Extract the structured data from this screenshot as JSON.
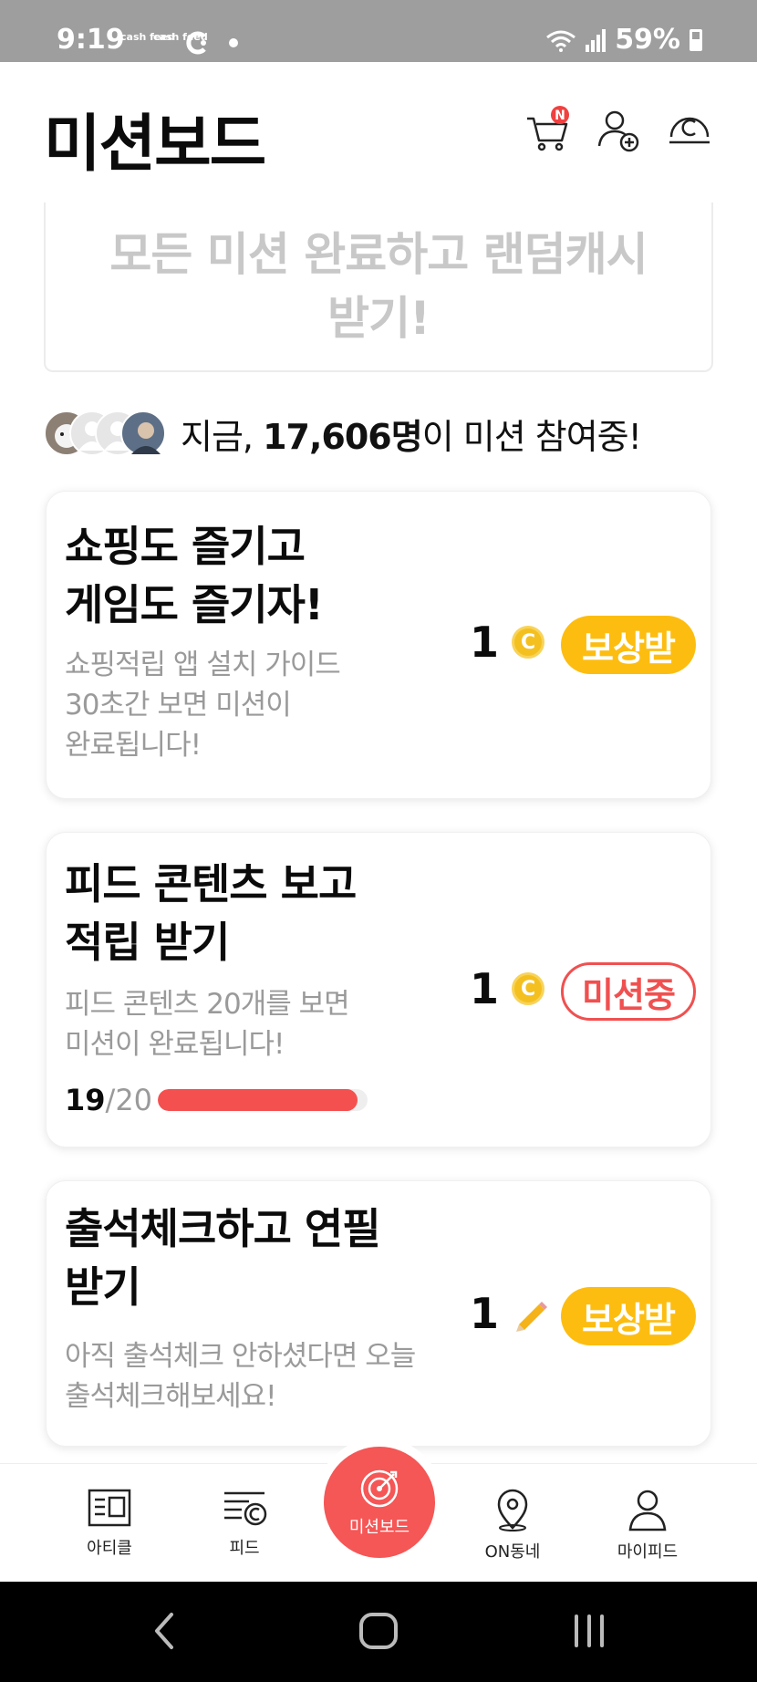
{
  "status_bar": {
    "time": "9:19",
    "app_icons": [
      "cash feed",
      "cash feed"
    ],
    "battery": "59%"
  },
  "header": {
    "title": "미션보드",
    "cart_badge": "N"
  },
  "banner": {
    "line1": "모든 미션 완료하고 랜덤캐시",
    "line2": "받기!"
  },
  "participants": {
    "prefix": "지금, ",
    "count": "17,606명",
    "suffix": "이 미션 참여중!"
  },
  "missions": [
    {
      "title": "쇼핑도 즐기고\n게임도 즐기자!",
      "description": "쇼핑적립 앱 설치 가이드\n30초간 보면 미션이\n완료됩니다!",
      "reward": "1",
      "reward_icon": "coin-icon",
      "button": "보상받",
      "status": "reward"
    },
    {
      "title": "피드 콘텐츠 보고\n적립 받기",
      "description": "피드 콘텐츠 20개를 보면\n미션이 완료됩니다!",
      "reward": "1",
      "reward_icon": "coin-icon",
      "button": "미션중",
      "status": "in-progress",
      "progress_current": "19",
      "progress_total": "/20",
      "progress_fraction": 0.95
    },
    {
      "title": "출석체크하고 연필\n받기",
      "description": "아직 출석체크 안하셨다면 오늘\n출석체크해보세요!",
      "reward": "1",
      "reward_icon": "pencil-icon",
      "button": "보상받",
      "status": "reward"
    }
  ],
  "bottom_nav": {
    "items": [
      {
        "label": "아티클",
        "icon": "article-icon"
      },
      {
        "label": "피드",
        "icon": "feed-icon"
      },
      {
        "label": "미션보드",
        "icon": "target-icon"
      },
      {
        "label": "ON동네",
        "icon": "location-pin-icon"
      },
      {
        "label": "마이피드",
        "icon": "person-icon"
      }
    ]
  },
  "colors": {
    "accent": "#f55656",
    "reward_button": "#fdbd10",
    "coin": "#f4c020"
  }
}
